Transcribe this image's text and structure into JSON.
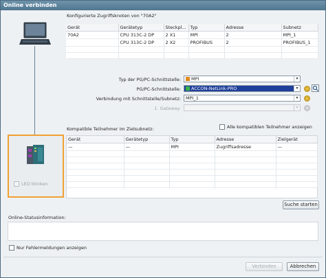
{
  "window": {
    "title": "Online verbinden"
  },
  "nodes": {
    "heading": "Konfigurierte Zugriffsknoten von \"70A2\"",
    "columns": [
      "Gerät",
      "Gerätetyp",
      "Steckpl...",
      "Typ",
      "Adresse",
      "Subnetz"
    ],
    "rows": [
      [
        "70A2",
        "CPU 313C-2 DP",
        "2 X1",
        "MPI",
        "2",
        "MPI_1"
      ],
      [
        "",
        "CPU 313C-2 DP",
        "2 X2",
        "PROFIBUS",
        "2",
        "PROFIBUS_1"
      ]
    ]
  },
  "interface": {
    "type_label": "Typ der PG/PC-Schnittstelle:",
    "type_value": "MPI",
    "pgpc_label": "PG/PC-Schnittstelle:",
    "pgpc_value": "ACCON-NetLink-PRO",
    "conn_label": "Verbindung mit Schnittstelle/Subnetz:",
    "conn_value": "MPI_1",
    "gateway_label": "1. Gateway:",
    "gateway_value": ""
  },
  "compatible": {
    "heading": "Kompatible Teilnehmer im Zielsubnetz:",
    "show_all_label": "Alle kompatiblen Teilnehmer anzeigen",
    "columns": [
      "Gerät",
      "Gerätetyp",
      "Typ",
      "Adresse",
      "Zielgerät"
    ],
    "rows": [
      [
        "—",
        "—",
        "MPI",
        "Zugriffsadresse",
        "—"
      ]
    ],
    "search_button": "Suche starten"
  },
  "led_blink_label": "LED blinken",
  "status": {
    "heading": "Online-Statusinformation:",
    "errors_only_label": "Nur Fehlermeldungen anzeigen"
  },
  "footer": {
    "connect_button": "Verbinden",
    "cancel_button": "Abbrechen"
  },
  "colors": {
    "accent": "#1f3f9a",
    "highlight_border": "#f0a030"
  }
}
